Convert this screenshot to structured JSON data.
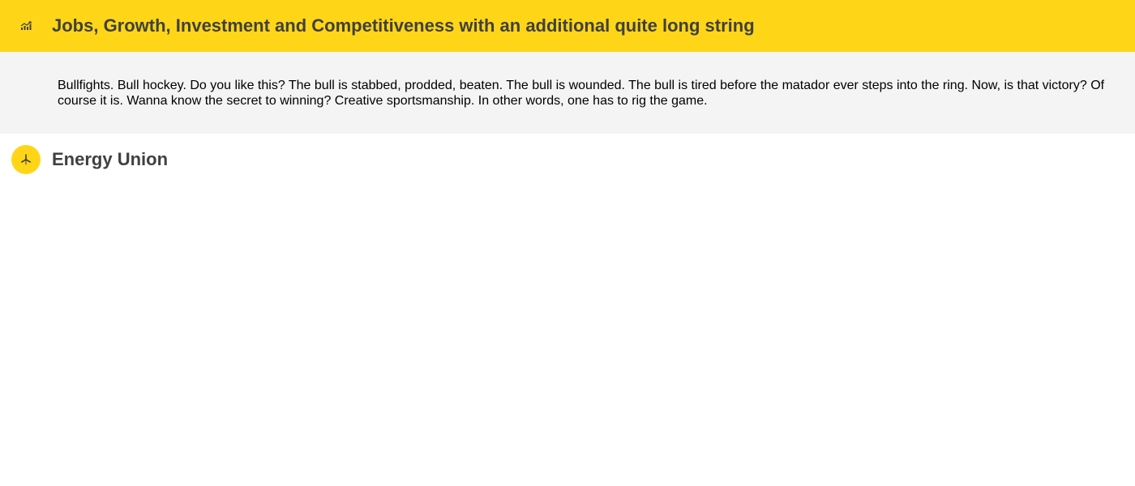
{
  "accordion": {
    "items": [
      {
        "icon": "chart-growth-icon",
        "title": "Jobs, Growth, Investment and Competitiveness with an additional quite long string",
        "expanded": true,
        "body": "Bullfights. Bull hockey. Do you like this? The bull is stabbed, prodded, beaten. The bull is wounded. The bull is tired before the matador ever steps into the ring. Now, is that victory? Of course it is. Wanna know the secret to winning? Creative sportsmanship. In other words, one has to rig the game."
      },
      {
        "icon": "wind-turbine-icon",
        "title": "Energy Union",
        "expanded": false
      }
    ]
  },
  "colors": {
    "accent": "#ffd617",
    "title_text": "#404040",
    "panel_background": "#f4f4f4"
  }
}
